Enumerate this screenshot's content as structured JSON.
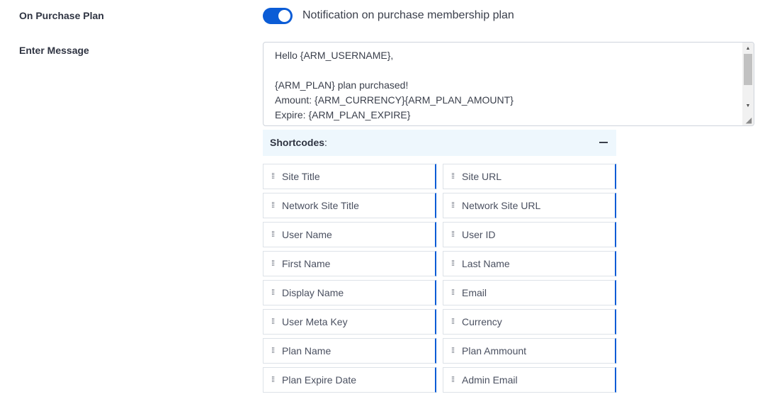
{
  "purchase_plan": {
    "label": "On Purchase Plan",
    "toggle_on": true,
    "toggle_text": "Notification on purchase membership plan"
  },
  "message": {
    "label": "Enter Message",
    "text": "Hello {ARM_USERNAME},\n\n{ARM_PLAN} plan purchased!\nAmount: {ARM_CURRENCY}{ARM_PLAN_AMOUNT}\nExpire: {ARM_PLAN_EXPIRE}"
  },
  "shortcodes": {
    "title": "Shortcodes",
    "colon": ":",
    "items": [
      {
        "label": "Site Title"
      },
      {
        "label": "Site URL"
      },
      {
        "label": "Network Site Title"
      },
      {
        "label": "Network Site URL"
      },
      {
        "label": "User Name"
      },
      {
        "label": "User ID"
      },
      {
        "label": "First Name"
      },
      {
        "label": "Last Name"
      },
      {
        "label": "Display Name"
      },
      {
        "label": "Email"
      },
      {
        "label": "User Meta Key"
      },
      {
        "label": "Currency"
      },
      {
        "label": "Plan Name"
      },
      {
        "label": "Plan Ammount"
      },
      {
        "label": "Plan Expire Date"
      },
      {
        "label": "Admin Email"
      }
    ]
  },
  "colors": {
    "accent": "#0b5cd6",
    "header_bg": "#eef7fd"
  }
}
